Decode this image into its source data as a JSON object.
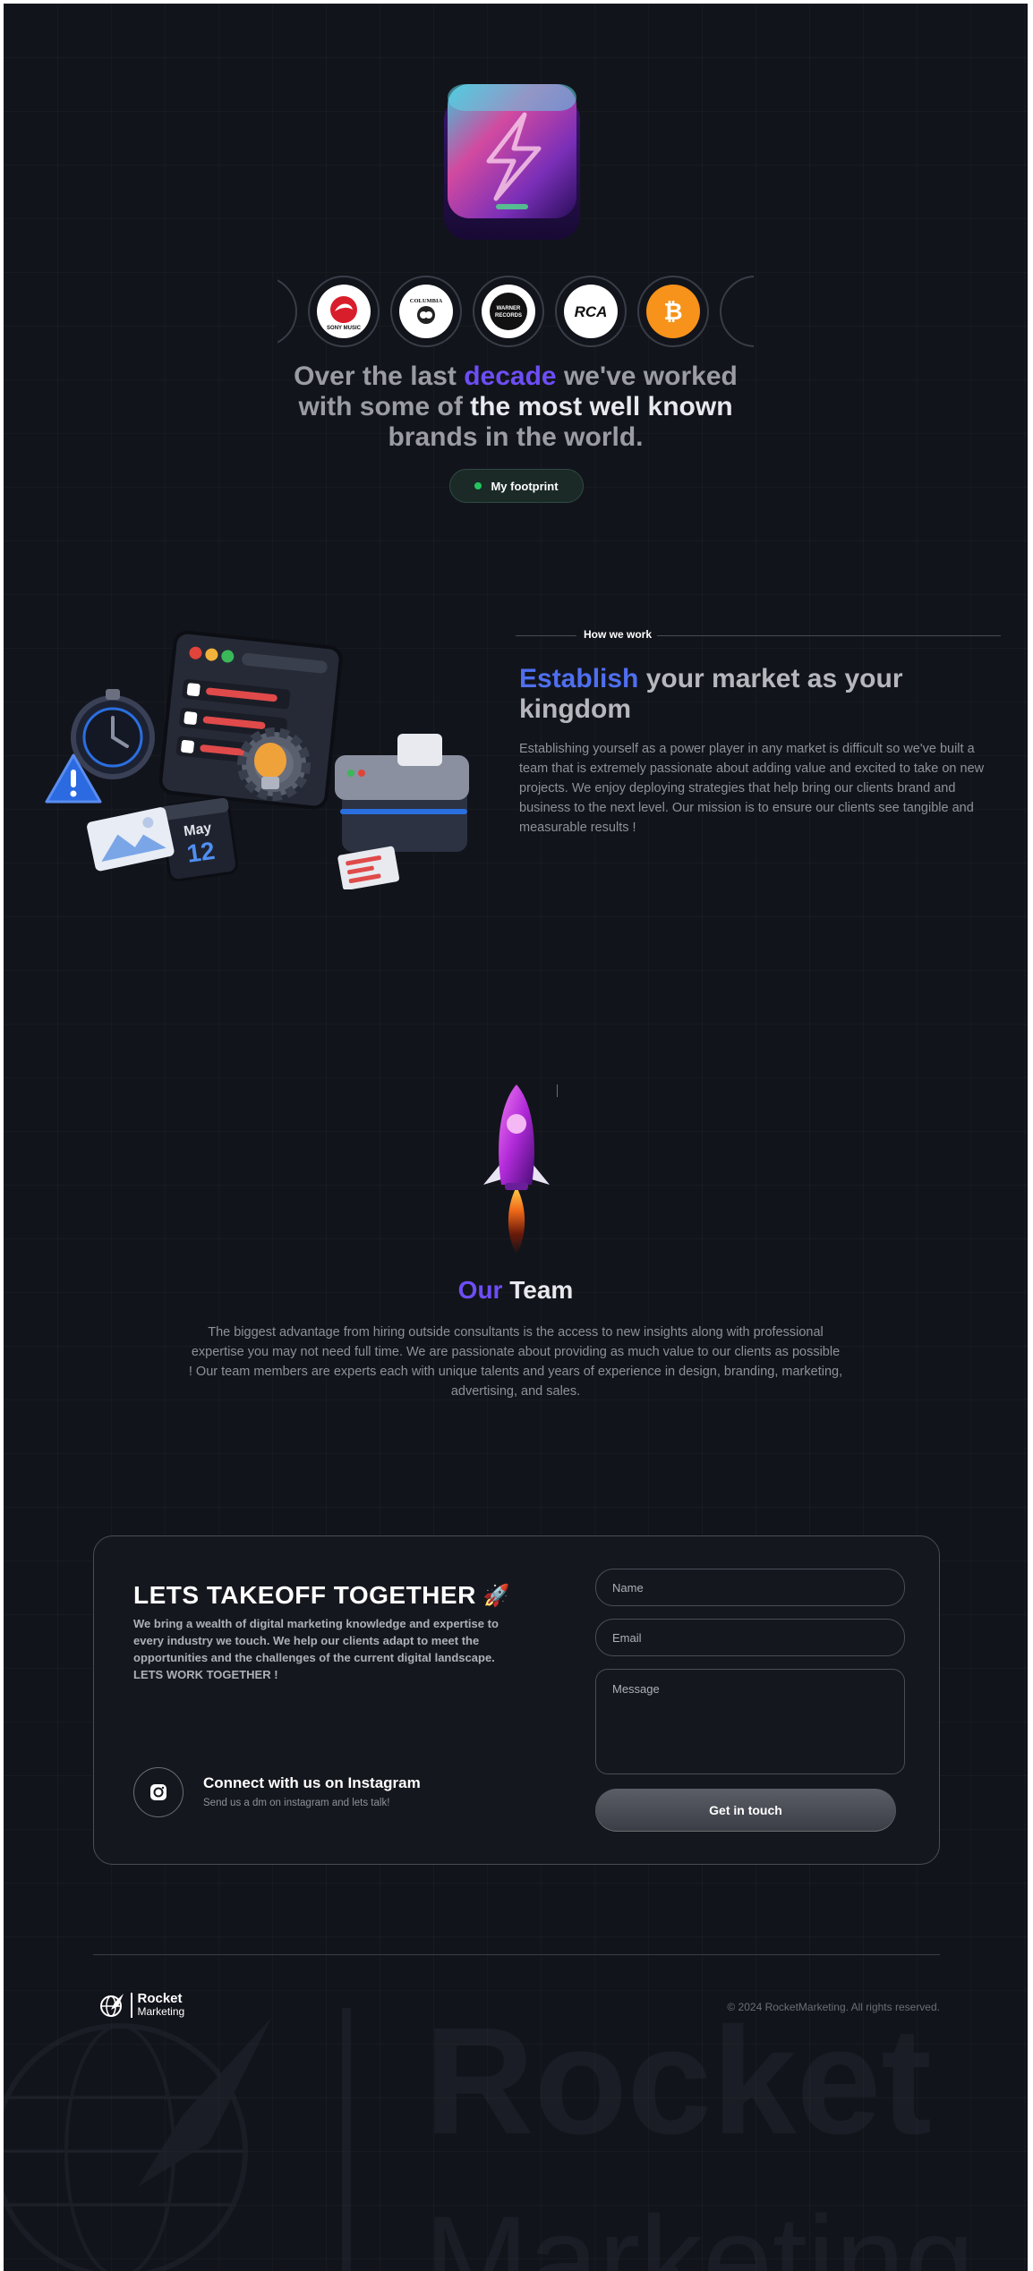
{
  "hero": {
    "heading_part1": "Over the last ",
    "heading_highlight": "decade",
    "heading_part2": " we've worked ",
    "heading_part3": "with some of ",
    "heading_part4": "the most well known",
    "heading_part5": "brands in the world.",
    "footprint_button": "My footprint",
    "brand_logos": [
      {
        "name": "Sony Music",
        "icon": "sony-music-logo",
        "text": "SONY MUSIC"
      },
      {
        "name": "Columbia",
        "icon": "columbia-logo",
        "text": "COLUMBIA"
      },
      {
        "name": "Warner Records",
        "icon": "warner-records-logo",
        "text": "WARNER RECORDS"
      },
      {
        "name": "RCA",
        "icon": "rca-logo",
        "text": "RCA"
      },
      {
        "name": "Bitcoin",
        "icon": "bitcoin-logo",
        "text": "₿"
      }
    ]
  },
  "how_we_work": {
    "label": "How we work",
    "title_highlight": "Establish",
    "title_rest": " your market as your kingdom",
    "body": "Establishing yourself as a power player in any market is difficult so we've built a team that is extremely passionate about adding value and excited to take on new projects. We enjoy deploying strategies that help bring our clients brand and business to the next level. Our mission is to ensure our clients see tangible and measurable results !",
    "calendar_month": "May",
    "calendar_day": "12"
  },
  "team": {
    "title_highlight": "Our",
    "title_rest": " Team",
    "body": "The biggest advantage from hiring outside consultants is the access to new insights along with professional expertise you may not need full time. We are passionate about providing as much value to our clients as possible ! Our team members are experts each with unique talents and years of experience in design, branding, marketing, advertising, and sales."
  },
  "contact": {
    "title": "LETS TAKEOFF TOGETHER",
    "title_emoji": "🚀",
    "body": "We bring a wealth of digital marketing knowledge and expertise to every industry we touch. We help our clients adapt to meet the opportunities and the challenges of the current digital landscape. LETS WORK TOGETHER !",
    "instagram_title": "Connect with us on Instagram",
    "instagram_sub": "Send us a dm on instagram and lets talk!",
    "name_placeholder": "Name",
    "email_placeholder": "Email",
    "message_placeholder": "Message",
    "submit_label": "Get in touch"
  },
  "footer": {
    "brand_line1": "Rocket",
    "brand_line2": "Marketing",
    "copyright": "© 2024 RocketMarketing. All rights reserved.",
    "watermark_line1": "Rocket",
    "watermark_line2": "Marketing"
  },
  "colors": {
    "background": "#12141b",
    "accent_purple": "#6d4ef5",
    "accent_blue": "#4f6ff0",
    "status_green": "#22c55e"
  }
}
